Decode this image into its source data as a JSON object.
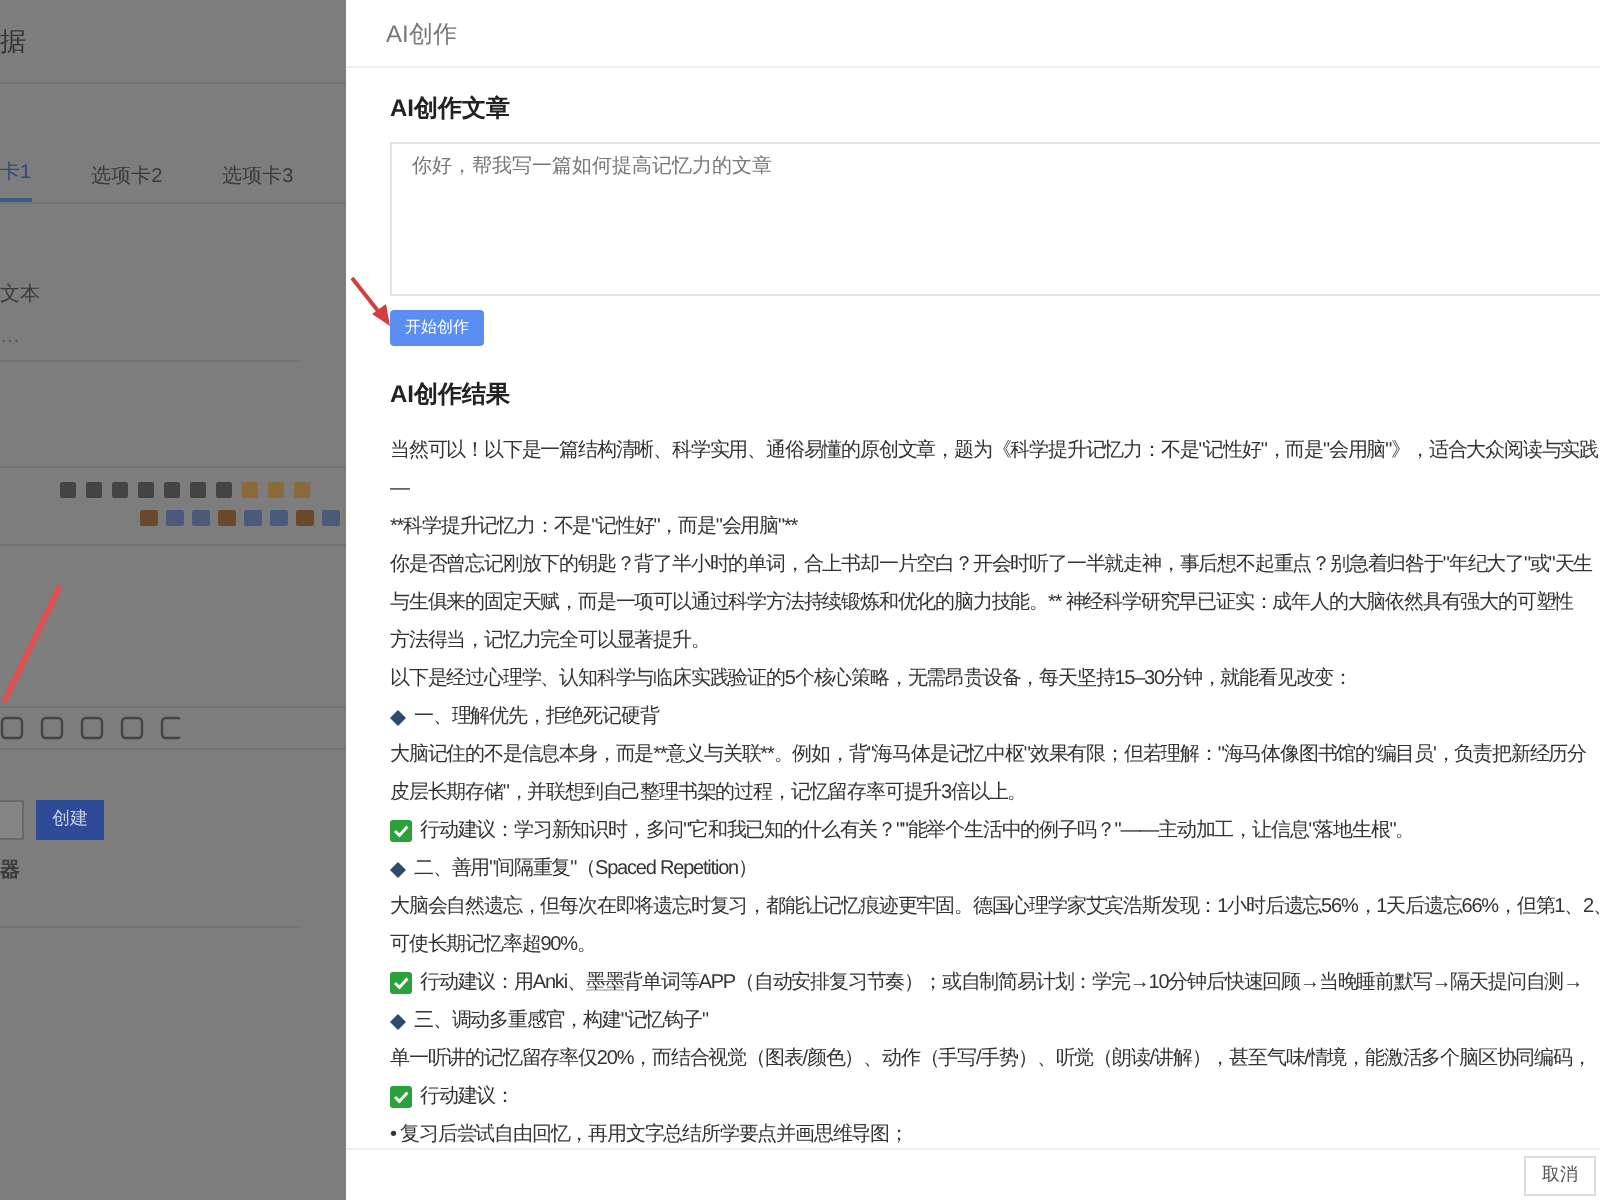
{
  "background_page": {
    "title": "据",
    "tabs": [
      {
        "label": "卡1",
        "selected": true
      },
      {
        "label": "选项卡2",
        "selected": false
      },
      {
        "label": "选项卡3",
        "selected": false
      }
    ],
    "field_label": "文本",
    "field_value": "…",
    "buttons": [
      {
        "kind": "plain"
      },
      {
        "label": "创建",
        "kind": "primary"
      }
    ],
    "label_2": "器"
  },
  "drawer": {
    "title": "AI创作",
    "compose": {
      "heading": "AI创作文章",
      "placeholder": "你好，帮我写一篇如何提高记忆力的文章",
      "button": "开始创作"
    },
    "result": {
      "heading": "AI创作结果",
      "lines": [
        {
          "kind": "text",
          "text": "当然可以！以下是一篇结构清晰、科学实用、通俗易懂的原创文章，题为《科学提升记忆力：不是\"记性好\"，而是\"会用脑\"》，适合大众阅读与实践"
        },
        {
          "kind": "text",
          "text": "—"
        },
        {
          "kind": "text",
          "text": "**科学提升记忆力：不是\"记性好\"，而是\"会用脑\"**"
        },
        {
          "kind": "text",
          "text": "你是否曾忘记刚放下的钥匙？背了半小时的单词，合上书却一片空白？开会时听了一半就走神，事后想不起重点？别急着归咎于\"年纪大了\"或\"天生"
        },
        {
          "kind": "text",
          "text": "与生俱来的固定天赋，而是一项可以通过科学方法持续锻炼和优化的脑力技能。** 神经科学研究早已证实：成年人的大脑依然具有强大的可塑性"
        },
        {
          "kind": "text",
          "text": "方法得当，记忆力完全可以显著提升。"
        },
        {
          "kind": "text",
          "text": "以下是经过心理学、认知科学与临床实践验证的5个核心策略，无需昂贵设备，每天坚持15–30分钟，就能看见改变："
        },
        {
          "kind": "heading",
          "text": "一、理解优先，拒绝死记硬背"
        },
        {
          "kind": "text",
          "text": "大脑记住的不是信息本身，而是**意义与关联**。例如，背\"海马体是记忆中枢\"效果有限；但若理解：\"海马体像图书馆的'编目员'，负责把新经历分"
        },
        {
          "kind": "text",
          "text": "皮层长期存储\"，并联想到自己整理书架的过程，记忆留存率可提升3倍以上。"
        },
        {
          "kind": "action",
          "text": "行动建议：学习新知识时，多问\"它和我已知的什么有关？\"\"能举个生活中的例子吗？\"——主动加工，让信息\"落地生根\"。"
        },
        {
          "kind": "heading",
          "text": "二、善用\"间隔重复\"（Spaced Repetition）"
        },
        {
          "kind": "text",
          "text": "大脑会自然遗忘，但每次在即将遗忘时复习，都能让记忆痕迹更牢固。德国心理学家艾宾浩斯发现：1小时后遗忘56%，1天后遗忘66%，但第1、2、"
        },
        {
          "kind": "text",
          "text": "可使长期记忆率超90%。"
        },
        {
          "kind": "action",
          "text": "行动建议：用Anki、墨墨背单词等APP（自动安排复习节奏）；或自制简易计划：学完→10分钟后快速回顾→当晚睡前默写→隔天提问自测→"
        },
        {
          "kind": "heading",
          "text": "三、调动多重感官，构建\"记忆钩子\""
        },
        {
          "kind": "text",
          "text": "单一听讲的记忆留存率仅20%，而结合视觉（图表/颜色）、动作（手写/手势）、听觉（朗读/讲解），甚至气味/情境，能激活多个脑区协同编码，"
        },
        {
          "kind": "action",
          "text": "行动建议："
        },
        {
          "kind": "text",
          "text": "• 复习后尝试自由回忆，再用文字总结所学要点并画思维导图；"
        }
      ]
    },
    "footer_button": "取消"
  }
}
